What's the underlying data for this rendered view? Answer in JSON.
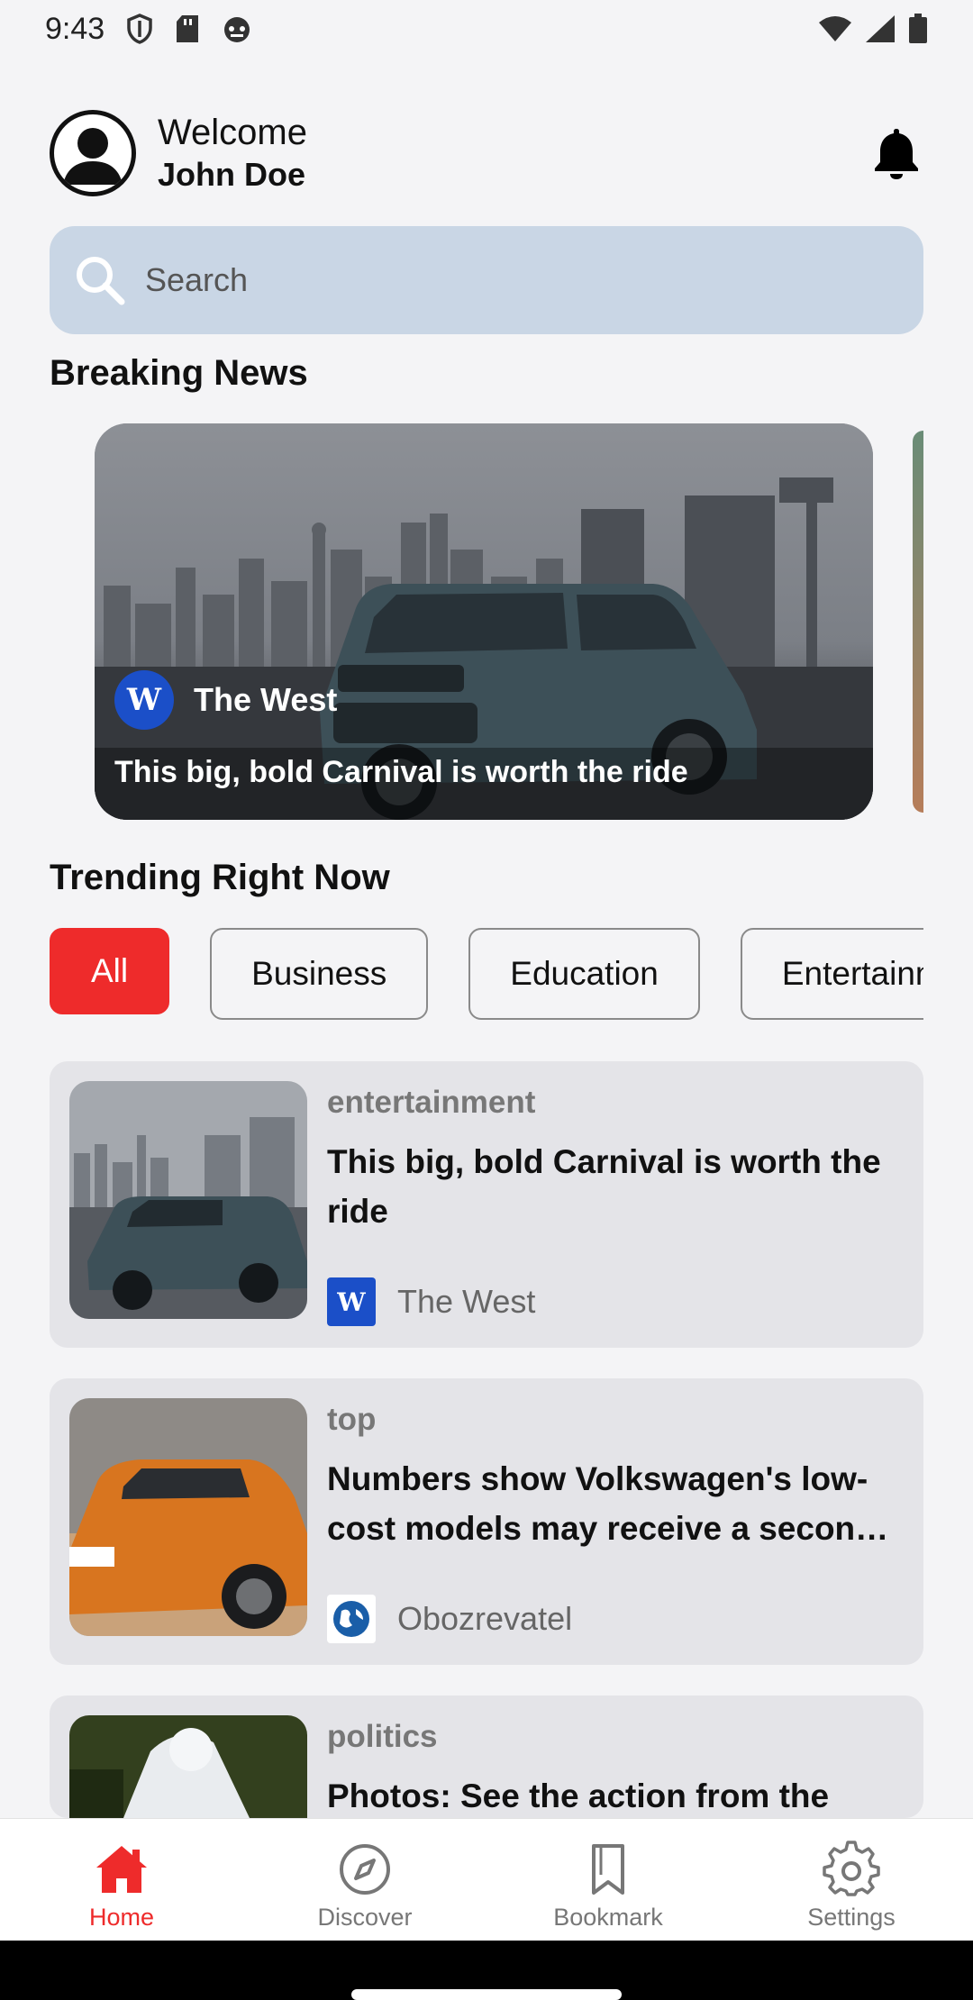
{
  "status_bar": {
    "time": "9:43"
  },
  "header": {
    "welcome": "Welcome",
    "user_name": "John Doe"
  },
  "search": {
    "placeholder": "Search"
  },
  "breaking": {
    "section_title": "Breaking News",
    "card": {
      "source": "The West",
      "source_logo_text": "W",
      "title": "This big, bold Carnival is worth the ride"
    }
  },
  "trending": {
    "section_title": "Trending Right Now",
    "chips": [
      "All",
      "Business",
      "Education",
      "Entertainment"
    ]
  },
  "news": [
    {
      "category": "entertainment",
      "title": "This big, bold Carnival is worth the ride",
      "source": "The West",
      "logo_text": "W",
      "logo_color": "#1b4fc8"
    },
    {
      "category": "top",
      "title": "Numbers show Volkswagen's low-cost models may receive a second life",
      "source": "Obozrevatel",
      "logo_color": "#1a5ea8"
    },
    {
      "category": "politics",
      "title": "Photos: See the action from the"
    }
  ],
  "nav": {
    "home": "Home",
    "discover": "Discover",
    "bookmark": "Bookmark",
    "settings": "Settings"
  },
  "colors": {
    "accent": "#ee2b2b",
    "search_bg": "#c9d6e5",
    "card_bg": "#e4e4e8"
  }
}
